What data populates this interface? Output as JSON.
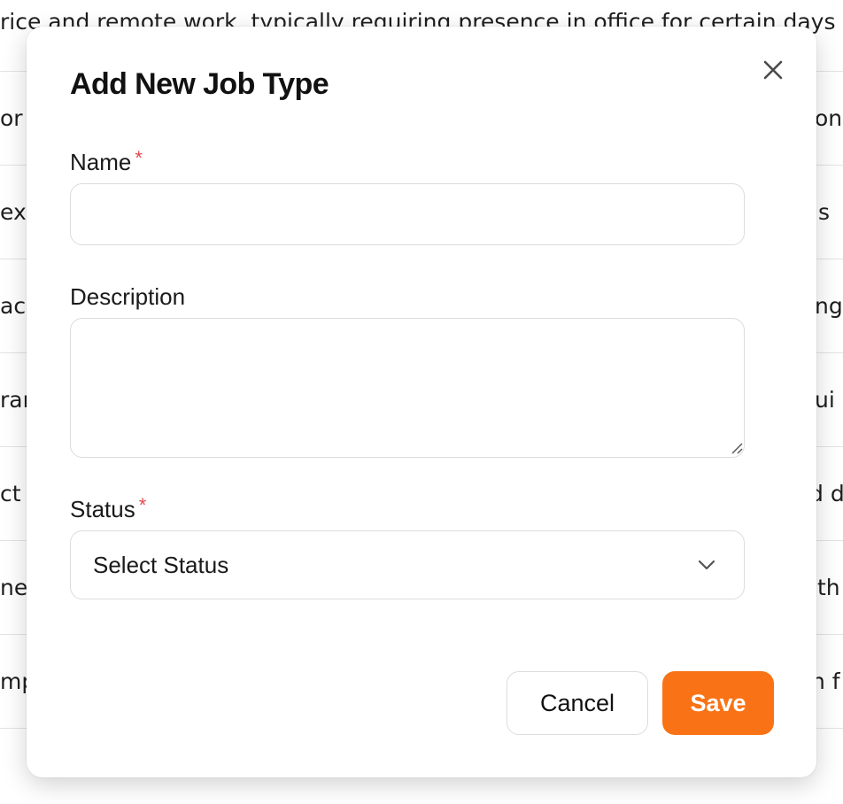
{
  "background": {
    "top_text": "rice and remote work, typically requiring presence in office for certain days",
    "rows": [
      {
        "left": "or",
        "right": "on"
      },
      {
        "left": "exp",
        "right": "s"
      },
      {
        "left": "ac",
        "right": "ng"
      },
      {
        "left": "rar",
        "right": "ui"
      },
      {
        "left": "ct c",
        "right": "d d"
      },
      {
        "left": "ne",
        "right": "ith"
      },
      {
        "left": "mp",
        "right": "n f"
      }
    ]
  },
  "modal": {
    "title": "Add New Job Type",
    "close_icon": "close-icon",
    "fields": {
      "name": {
        "label": "Name",
        "required_mark": "*",
        "value": "",
        "placeholder": ""
      },
      "description": {
        "label": "Description",
        "value": "",
        "placeholder": ""
      },
      "status": {
        "label": "Status",
        "required_mark": "*",
        "selected": "Select Status"
      }
    },
    "buttons": {
      "cancel": "Cancel",
      "save": "Save"
    },
    "colors": {
      "accent": "#f97316",
      "required": "#e5484d",
      "border": "#dcdcdc"
    }
  }
}
